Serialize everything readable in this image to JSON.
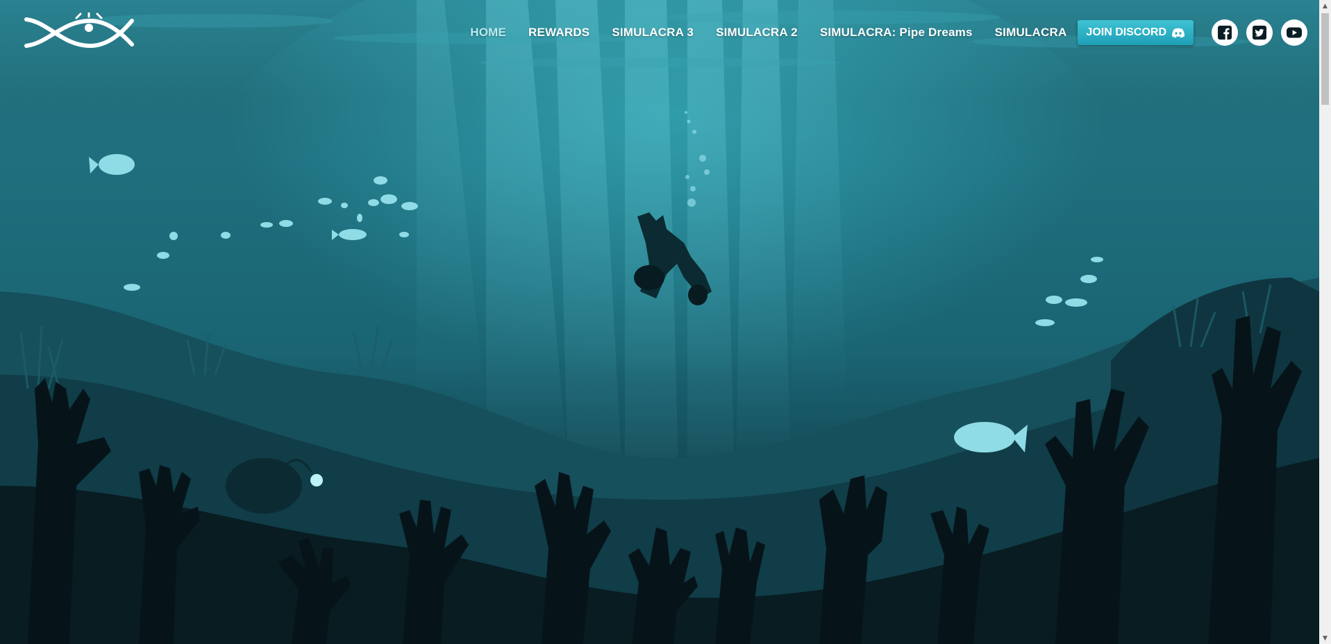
{
  "site": {
    "logo": "fish-eye-logo"
  },
  "nav": {
    "items": [
      {
        "label": "HOME",
        "active": true
      },
      {
        "label": "REWARDS",
        "active": false
      },
      {
        "label": "SIMULACRA 3",
        "active": false
      },
      {
        "label": "SIMULACRA 2",
        "active": false
      },
      {
        "label": "SIMULACRA: Pipe Dreams",
        "active": false
      },
      {
        "label": "SIMULACRA",
        "active": false
      }
    ],
    "discord_label": "JOIN DISCORD",
    "social": [
      "facebook-icon",
      "twitter-icon",
      "youtube-icon"
    ]
  },
  "hero": {
    "scene": "underwater-falling-figure",
    "colors": {
      "water_top": "#2a8f9f",
      "water_mid": "#1b6f7e",
      "water_deep": "#0e3c47",
      "silhouette": "#07151a",
      "fish": "#8fdbe6",
      "accent": "#2bb3c6"
    }
  }
}
